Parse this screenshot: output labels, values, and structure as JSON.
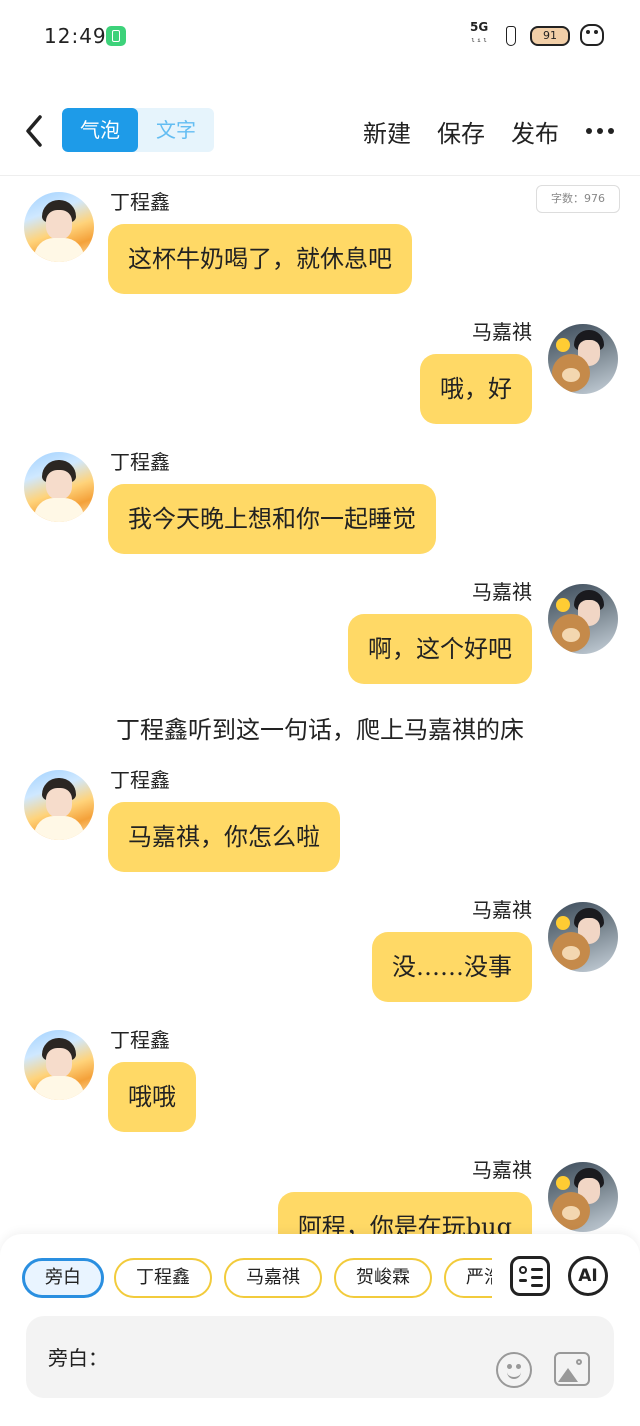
{
  "status_bar": {
    "time": "12:49",
    "network": "5G",
    "network_sub": "ₗᵢₗ",
    "battery": "91"
  },
  "header": {
    "tab_bubble": "气泡",
    "tab_text": "文字",
    "new_label": "新建",
    "save_label": "保存",
    "publish_label": "发布"
  },
  "word_count": "字数：976",
  "messages": [
    {
      "side": "left",
      "name": "丁程鑫",
      "text": "这杯牛奶喝了，就休息吧"
    },
    {
      "side": "right",
      "name": "马嘉祺",
      "text": "哦，好"
    },
    {
      "side": "left",
      "name": "丁程鑫",
      "text": "我今天晚上想和你一起睡觉"
    },
    {
      "side": "right",
      "name": "马嘉祺",
      "text": "啊，这个好吧"
    },
    {
      "side": "narration",
      "text": "丁程鑫听到这一句话，爬上马嘉祺的床"
    },
    {
      "side": "left",
      "name": "丁程鑫",
      "text": "马嘉祺，你怎么啦"
    },
    {
      "side": "right",
      "name": "马嘉祺",
      "text": "没……没事"
    },
    {
      "side": "left",
      "name": "丁程鑫",
      "text": "哦哦"
    },
    {
      "side": "right",
      "name": "马嘉祺",
      "text": "阿程，你是在玩bug"
    }
  ],
  "roles": [
    "旁白",
    "丁程鑫",
    "马嘉祺",
    "贺峻霖",
    "严浩翔"
  ],
  "input": {
    "label": "旁白："
  },
  "colors": {
    "bubble": "#ffd966",
    "accent": "#1e9be8",
    "chip_border": "#f2cb3c"
  }
}
